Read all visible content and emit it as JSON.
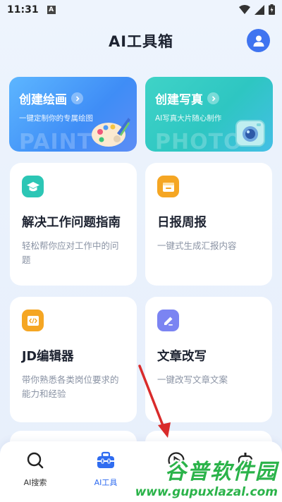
{
  "status_bar": {
    "time": "11:31",
    "a_badge": "A"
  },
  "header": {
    "title": "AI工具箱"
  },
  "promos": [
    {
      "title": "创建绘画",
      "subtitle": "一键定制你的专属绘图",
      "watermark": "PAINT"
    },
    {
      "title": "创建写真",
      "subtitle": "AI写真大片随心制作",
      "watermark": "PHOTO"
    }
  ],
  "tools": [
    {
      "title": "解决工作问题指南",
      "desc": "轻松帮你应对工作中的问题",
      "icon": "graduation-cap-icon",
      "color": "#2cc6b5"
    },
    {
      "title": "日报周报",
      "desc": "一键式生成汇报内容",
      "icon": "calendar-icon",
      "color": "#f5a623"
    },
    {
      "title": "JD编辑器",
      "desc": "带你熟悉各类岗位要求的能力和经验",
      "icon": "code-doc-icon",
      "color": "#f5a623"
    },
    {
      "title": "文章改写",
      "desc": "一键改写文章文案",
      "icon": "pencil-icon",
      "color": "#7b84f2"
    }
  ],
  "bottom_nav": {
    "items": [
      {
        "label": "AI搜索",
        "icon": "search-icon"
      },
      {
        "label": "AI工具",
        "icon": "toolbox-icon",
        "active": true
      },
      {
        "label": "",
        "icon": "play-circle-icon"
      },
      {
        "label": "",
        "icon": "robot-icon"
      }
    ]
  },
  "watermark": {
    "brand": "谷普软件园",
    "url": "www.gupuxlazal.com"
  },
  "colors": {
    "accent": "#3f74f0",
    "background": "#eef4fd"
  }
}
